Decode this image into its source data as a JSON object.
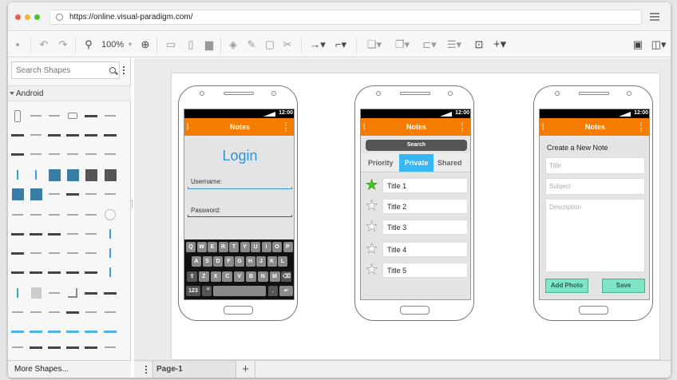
{
  "browser": {
    "url": "https://online.visual-paradigm.com/",
    "colors": {
      "close": "#ee5b51",
      "minimize": "#f5b33b",
      "maximize": "#4ec02e"
    }
  },
  "toolbar": {
    "zoom_label": "100%",
    "icons": [
      "save-icon",
      "undo-icon",
      "redo-icon",
      "zoom-out-icon",
      "zoom-in-icon",
      "copy-icon",
      "paste-icon",
      "delete-icon",
      "fill-color-icon",
      "line-color-icon",
      "shadow-icon",
      "format-painter-icon",
      "connector-icon",
      "waypoint-icon",
      "to-front-icon",
      "to-back-icon",
      "align-icon",
      "distribute-icon",
      "group-icon",
      "insert-icon",
      "panel-icon",
      "sidebar-toggle-icon"
    ]
  },
  "sidebar": {
    "search_placeholder": "Search Shapes",
    "section_label": "Android",
    "more_shapes": "More Shapes..."
  },
  "pagebar": {
    "page_tab": "Page-1",
    "add_symbol": "+"
  },
  "phones": {
    "login": {
      "time": "12:00",
      "title": "Notes",
      "heading": "Login",
      "username_label": "Username:",
      "password_label": "Password:",
      "keys_row1": [
        "Q",
        "W",
        "E",
        "R",
        "T",
        "Y",
        "U",
        "I",
        "O",
        "P"
      ],
      "keys_row2": [
        "A",
        "S",
        "D",
        "F",
        "G",
        "H",
        "J",
        "K",
        "L"
      ],
      "keys_row3": [
        "⇧",
        "Z",
        "X",
        "C",
        "V",
        "B",
        "N",
        "M",
        "⌫"
      ],
      "key_123": "123",
      "key_mic": "🎤",
      "key_period": ".",
      "key_enter": "↵"
    },
    "list": {
      "time": "12:00",
      "title": "Notes",
      "search_label": "Search",
      "tabs": [
        "Priority",
        "Private",
        "Shared"
      ],
      "active_tab": "Private",
      "items": [
        "Title 1",
        "Title 2",
        "Title 3",
        "Title 4",
        "Title 5"
      ]
    },
    "create": {
      "time": "12:00",
      "title": "Notes",
      "heading": "Create a New Note",
      "title_placeholder": "Title",
      "subject_placeholder": "Subject",
      "description_placeholder": "Description",
      "add_photo": "Add Photo",
      "save": "Save"
    }
  }
}
